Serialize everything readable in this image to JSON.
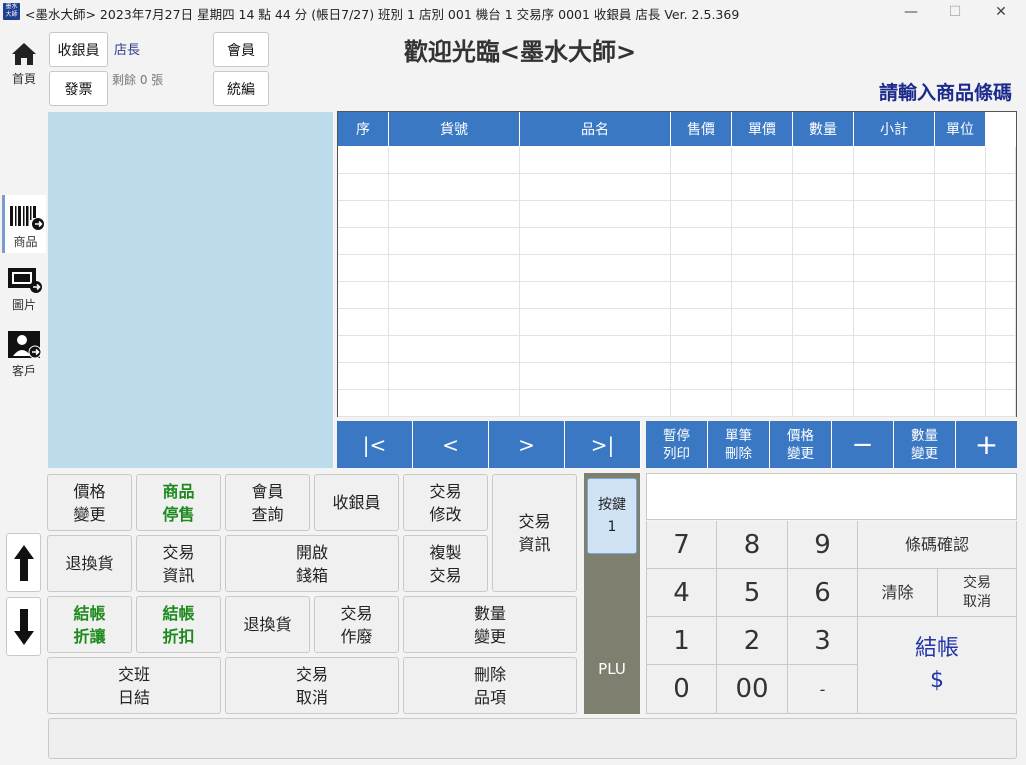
{
  "window": {
    "icon_text": "墨水 大師",
    "title": "<墨水大師> 2023年7月27日 星期四 14 點 44 分 (帳日7/27) 班別 1 店別 001 機台 1 交易序 0001 收銀員 店長  Ver. 2.5.369",
    "minimize": "—",
    "maximize": "☐",
    "close": "✕"
  },
  "sidebar": {
    "items": [
      {
        "label": "首頁",
        "icon": "home-icon"
      },
      {
        "label": "商品",
        "icon": "barcode-icon"
      },
      {
        "label": "圖片",
        "icon": "picture-icon"
      },
      {
        "label": "客戶",
        "icon": "customer-icon"
      }
    ]
  },
  "header": {
    "cashier_button": "收銀員",
    "cashier_name": "店長",
    "invoice_button": "發票",
    "invoice_remaining": "剩餘 0 張",
    "member_button": "會員",
    "tax_id_button": "統編",
    "welcome": "歡迎光臨<墨水大師>",
    "prompt": "請輸入商品條碼"
  },
  "table": {
    "columns": [
      "序",
      "貨號",
      "品名",
      "售價",
      "單價",
      "數量",
      "小計",
      "單位"
    ],
    "rows": []
  },
  "pager": {
    "first": "|<",
    "prev": "<",
    "next": ">",
    "last": ">|",
    "pause_print": [
      "暫停",
      "列印"
    ],
    "delete_one": [
      "單筆",
      "刪除"
    ],
    "price_change": [
      "價格",
      "變更"
    ],
    "minus": "−",
    "qty_change": [
      "數量",
      "變更"
    ],
    "plus": "+"
  },
  "functions": {
    "price_change": [
      "價格",
      "變更"
    ],
    "product_suspend": [
      "商品",
      "停售"
    ],
    "member_query": [
      "會員",
      "查詢"
    ],
    "cashier": [
      "收銀員"
    ],
    "txn_modify": [
      "交易",
      "修改"
    ],
    "txn_info_big": [
      "交易",
      "資訊"
    ],
    "return_exchange": [
      "退換貨"
    ],
    "txn_info": [
      "交易",
      "資訊"
    ],
    "open_drawer": [
      "開啟",
      "錢箱"
    ],
    "copy_txn": [
      "複製",
      "交易"
    ],
    "checkout_discount": [
      "結帳",
      "折讓"
    ],
    "checkout_rebate": [
      "結帳",
      "折扣"
    ],
    "return_exchange2": [
      "退換貨"
    ],
    "txn_void": [
      "交易",
      "作廢"
    ],
    "qty_change": [
      "數量",
      "變更"
    ],
    "shift_close": [
      "交班",
      "日結"
    ],
    "txn_cancel": [
      "交易",
      "取消"
    ],
    "delete_item": [
      "刪除",
      "品項"
    ]
  },
  "plu": {
    "key_button": [
      "按鍵",
      "1"
    ],
    "label": "PLU"
  },
  "keypad": {
    "display_value": "",
    "k7": "7",
    "k8": "8",
    "k9": "9",
    "k4": "4",
    "k5": "5",
    "k6": "6",
    "k1": "1",
    "k2": "2",
    "k3": "3",
    "k0": "0",
    "k00": "00",
    "kdash": "-",
    "barcode_confirm": "條碼確認",
    "clear": "清除",
    "txn_cancel": [
      "交易",
      "取消"
    ],
    "checkout": [
      "結帳",
      "$"
    ]
  },
  "status": {
    "text": ""
  }
}
